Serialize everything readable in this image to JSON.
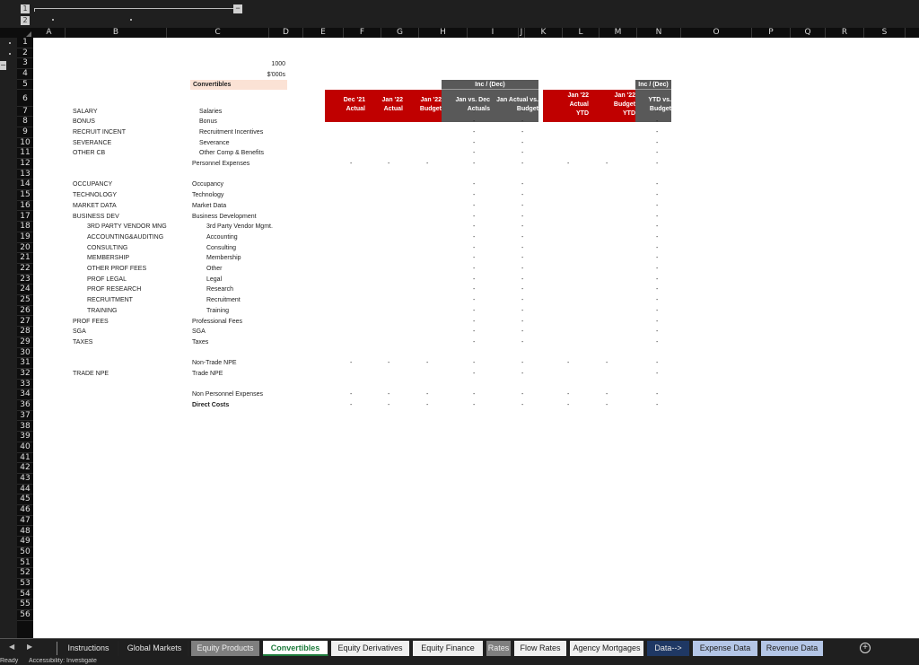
{
  "outline": {
    "column_levels": [
      "1",
      "2"
    ],
    "row_levels": [
      "1",
      "2"
    ],
    "collapse_symbol": "−"
  },
  "columns": [
    "A",
    "B",
    "C",
    "D",
    "E",
    "F",
    "G",
    "H",
    "I",
    "J",
    "K",
    "L",
    "M",
    "N",
    "O",
    "P",
    "Q",
    "R",
    "S"
  ],
  "rows": [
    "1",
    "2",
    "3",
    "4",
    "5",
    "6",
    "7",
    "8",
    "9",
    "10",
    "11",
    "12",
    "13",
    "14",
    "15",
    "16",
    "17",
    "18",
    "19",
    "20",
    "21",
    "22",
    "23",
    "24",
    "25",
    "26",
    "27",
    "28",
    "29",
    "30",
    "31",
    "32",
    "33",
    "34",
    "36",
    "37",
    "38",
    "39",
    "40",
    "41",
    "42",
    "43",
    "44",
    "45",
    "46",
    "47",
    "48",
    "49",
    "50",
    "51",
    "52",
    "53",
    "54",
    "55",
    "56"
  ],
  "sheet": {
    "unit_value": "1000",
    "unit_label": "$'000s",
    "title": "Convertibles",
    "headers": {
      "inc_dec_1": "Inc / (Dec)",
      "inc_dec_2": "Inc / (Dec)",
      "dec21_actual": [
        "Dec '21",
        "Actual"
      ],
      "jan22_actual": [
        "Jan '22",
        "Actual"
      ],
      "jan22_budget": [
        "Jan '22",
        "Budget"
      ],
      "jan_vs_dec": [
        "Jan vs. Dec",
        "Actuals"
      ],
      "jan_actual_vs_budget": [
        "Jan Actual vs.",
        "Budget"
      ],
      "jan22_actual_ytd": [
        "Jan '22",
        "Actual",
        "YTD"
      ],
      "jan22_budget_ytd": [
        "Jan '22",
        "Budget",
        "YTD"
      ],
      "ytd_vs_budget": [
        "YTD vs.",
        "Budget"
      ]
    },
    "lines": [
      {
        "row": 7,
        "code": "SALARY",
        "label": "Salaries",
        "indent_code": 0,
        "indent_label": 1,
        "values": {
          "H": "-",
          "I": "-",
          "M": "-"
        }
      },
      {
        "row": 8,
        "code": "BONUS",
        "label": "Bonus",
        "indent_code": 0,
        "indent_label": 1,
        "values": {
          "H": "-",
          "I": "-",
          "M": "-"
        }
      },
      {
        "row": 9,
        "code": "RECRUIT INCENT",
        "label": "Recruitment Incentives",
        "indent_code": 0,
        "indent_label": 1,
        "values": {
          "H": "-",
          "I": "-",
          "M": "-"
        }
      },
      {
        "row": 10,
        "code": "SEVERANCE",
        "label": "Severance",
        "indent_code": 0,
        "indent_label": 1,
        "values": {
          "H": "-",
          "I": "-",
          "M": "-"
        }
      },
      {
        "row": 11,
        "code": "OTHER CB",
        "label": "Other Comp & Benefits",
        "indent_code": 0,
        "indent_label": 1,
        "values": {
          "H": "-",
          "I": "-",
          "M": "-"
        }
      },
      {
        "row": 12,
        "code": "",
        "label": "Personnel Expenses",
        "indent_code": 0,
        "indent_label": 0,
        "values": {
          "E": "-",
          "F": "-",
          "G": "-",
          "H": "-",
          "I": "-",
          "K": "-",
          "L": "-",
          "M": "-"
        }
      },
      {
        "row": 14,
        "code": "OCCUPANCY",
        "label": "Occupancy",
        "indent_code": 0,
        "indent_label": 0,
        "values": {
          "H": "-",
          "I": "-",
          "M": "-"
        }
      },
      {
        "row": 15,
        "code": "TECHNOLOGY",
        "label": "Technology",
        "indent_code": 0,
        "indent_label": 0,
        "values": {
          "H": "-",
          "I": "-",
          "M": "-"
        }
      },
      {
        "row": 16,
        "code": "MARKET DATA",
        "label": "Market Data",
        "indent_code": 0,
        "indent_label": 0,
        "values": {
          "H": "-",
          "I": "-",
          "M": "-"
        }
      },
      {
        "row": 17,
        "code": "BUSINESS DEV",
        "label": "Business Development",
        "indent_code": 0,
        "indent_label": 0,
        "values": {
          "H": "-",
          "I": "-",
          "M": "-"
        }
      },
      {
        "row": 18,
        "code": "3RD PARTY VENDOR MNG",
        "label": "3rd Party Vendor Mgmt.",
        "indent_code": 1,
        "indent_label": 1,
        "values": {
          "H": "-",
          "I": "-",
          "M": "-"
        }
      },
      {
        "row": 19,
        "code": "ACCOUNTING&AUDITING",
        "label": "Accounting",
        "indent_code": 1,
        "indent_label": 1,
        "values": {
          "H": "-",
          "I": "-",
          "M": "-"
        }
      },
      {
        "row": 20,
        "code": "CONSULTING",
        "label": "Consulting",
        "indent_code": 1,
        "indent_label": 1,
        "values": {
          "H": "-",
          "I": "-",
          "M": "-"
        }
      },
      {
        "row": 21,
        "code": "MEMBERSHIP",
        "label": "Membership",
        "indent_code": 1,
        "indent_label": 1,
        "values": {
          "H": "-",
          "I": "-",
          "M": "-"
        }
      },
      {
        "row": 22,
        "code": "OTHER PROF FEES",
        "label": "Other",
        "indent_code": 1,
        "indent_label": 1,
        "values": {
          "H": "-",
          "I": "-",
          "M": "-"
        }
      },
      {
        "row": 23,
        "code": "PROF LEGAL",
        "label": "Legal",
        "indent_code": 1,
        "indent_label": 1,
        "values": {
          "H": "-",
          "I": "-",
          "M": "-"
        }
      },
      {
        "row": 24,
        "code": "PROF RESEARCH",
        "label": "Research",
        "indent_code": 1,
        "indent_label": 1,
        "values": {
          "H": "-",
          "I": "-",
          "M": "-"
        }
      },
      {
        "row": 25,
        "code": "RECRUITMENT",
        "label": "Recruitment",
        "indent_code": 1,
        "indent_label": 1,
        "values": {
          "H": "-",
          "I": "-",
          "M": "-"
        }
      },
      {
        "row": 26,
        "code": "TRAINING",
        "label": "Training",
        "indent_code": 1,
        "indent_label": 1,
        "values": {
          "H": "-",
          "I": "-",
          "M": "-"
        }
      },
      {
        "row": 27,
        "code": "PROF FEES",
        "label": "Professional Fees",
        "indent_code": 0,
        "indent_label": 0,
        "values": {
          "H": "-",
          "I": "-",
          "M": "-"
        }
      },
      {
        "row": 28,
        "code": "SGA",
        "label": "SGA",
        "indent_code": 0,
        "indent_label": 0,
        "values": {
          "H": "-",
          "I": "-",
          "M": "-"
        }
      },
      {
        "row": 29,
        "code": "TAXES",
        "label": "Taxes",
        "indent_code": 0,
        "indent_label": 0,
        "values": {
          "H": "-",
          "I": "-",
          "M": "-"
        }
      },
      {
        "row": 31,
        "code": "",
        "label": "Non-Trade NPE",
        "indent_code": 0,
        "indent_label": 0,
        "values": {
          "E": "-",
          "F": "-",
          "G": "-",
          "H": "-",
          "I": "-",
          "K": "-",
          "L": "-",
          "M": "-"
        }
      },
      {
        "row": 32,
        "code": "TRADE NPE",
        "label": "Trade NPE",
        "indent_code": 0,
        "indent_label": 0,
        "values": {
          "H": "-",
          "I": "-",
          "M": "-"
        }
      },
      {
        "row": 34,
        "code": "",
        "label": "Non Personnel Expenses",
        "indent_code": 0,
        "indent_label": 0,
        "values": {
          "E": "-",
          "F": "-",
          "G": "-",
          "H": "-",
          "I": "-",
          "K": "-",
          "L": "-",
          "M": "-"
        }
      },
      {
        "row": 36,
        "code": "",
        "label": "Direct Costs",
        "bold": true,
        "indent_code": 0,
        "indent_label": 0,
        "values": {
          "E": "-",
          "F": "-",
          "G": "-",
          "H": "-",
          "I": "-",
          "K": "-",
          "L": "-",
          "M": "-"
        }
      }
    ]
  },
  "tabs": {
    "nav_prev": "◀",
    "nav_next": "▶",
    "items": [
      {
        "label": "Instructions",
        "style": "dark"
      },
      {
        "label": "Global Markets",
        "style": "dark"
      },
      {
        "label": "Equity Products",
        "style": "gray"
      },
      {
        "label": "Convertibles",
        "style": "active"
      },
      {
        "label": "Equity Derivatives",
        "style": "white"
      },
      {
        "label": "Equity Finance",
        "style": "white"
      },
      {
        "label": "Rates",
        "style": "gray"
      },
      {
        "label": "Flow Rates",
        "style": "white"
      },
      {
        "label": "Agency Mortgages",
        "style": "white"
      },
      {
        "label": "Data-->",
        "style": "navy"
      },
      {
        "label": "Expense Data",
        "style": "lightblue"
      },
      {
        "label": "Revenue Data",
        "style": "lightblue"
      }
    ],
    "add_sheet": "+"
  },
  "status": {
    "mode": "Ready",
    "accessibility": "Accessibility: Investigate"
  },
  "colors": {
    "header_red": "#c00000",
    "header_gray": "#595959",
    "title_fill": "#fbe2d5",
    "active_tab_text": "#1e7b3c",
    "data_tab": "#1f3864",
    "data_sheet_tab": "#b4c6e7"
  }
}
